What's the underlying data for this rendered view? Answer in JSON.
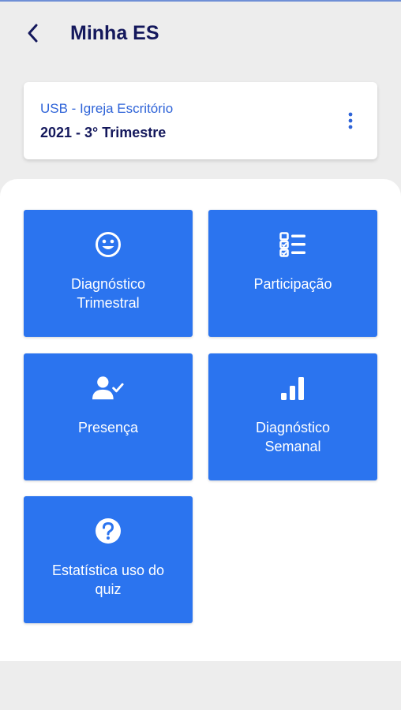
{
  "header": {
    "title": "Minha ES",
    "back_icon": "chevron-left-icon"
  },
  "context": {
    "location": "USB - Igreja Escritório",
    "period": "2021 - 3° Trimestre",
    "menu_icon": "more-vertical-icon"
  },
  "tiles": [
    {
      "label": "Diagnóstico\nTrimestral",
      "icon": "smiley-icon"
    },
    {
      "label": "Participação",
      "icon": "checklist-icon"
    },
    {
      "label": "Presença",
      "icon": "user-check-icon"
    },
    {
      "label": "Diagnóstico\nSemanal",
      "icon": "signal-bars-icon"
    },
    {
      "label": "Estatística uso do\nquiz",
      "icon": "question-circle-icon"
    }
  ],
  "colors": {
    "tile": "#2b74ef",
    "title": "#14185c",
    "accent": "#2f64d8",
    "background": "#ededed"
  }
}
